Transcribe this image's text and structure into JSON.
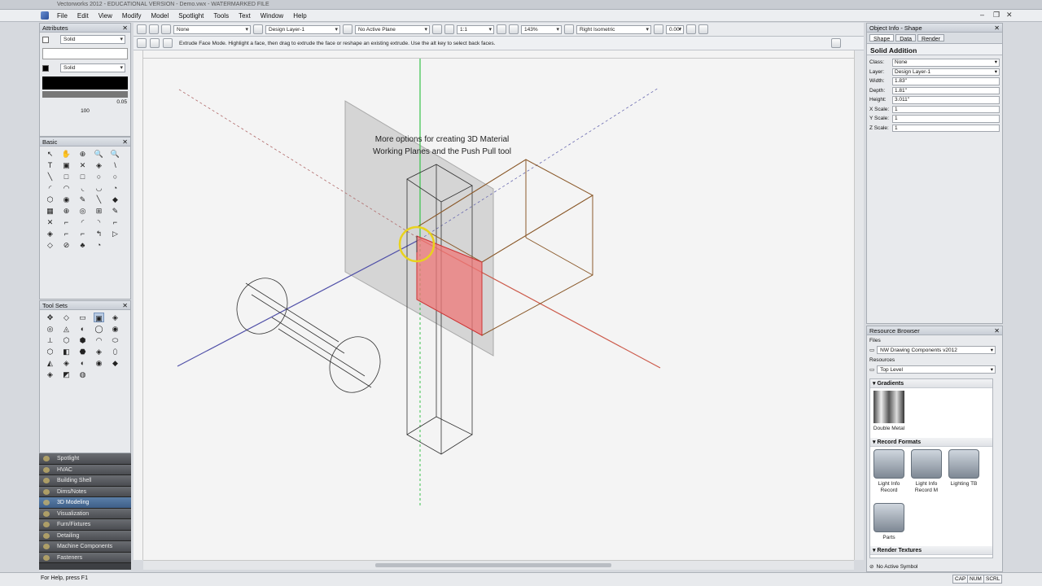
{
  "window": {
    "title": "Vectorworks 2012 - EDUCATIONAL VERSION - Demo.vwx - WATERMARKED FILE"
  },
  "menu": [
    "File",
    "Edit",
    "View",
    "Modify",
    "Model",
    "Spotlight",
    "Tools",
    "Text",
    "Window",
    "Help"
  ],
  "viewbar": {
    "class": "None",
    "layer": "Design Layer-1",
    "plane": "No Active Plane",
    "scale": "1:1",
    "zoom": "143%",
    "view": "Right Isometric",
    "rotation": "0.00°"
  },
  "mode": {
    "help": "Extrude Face Mode. Highlight a face, then drag to extrude the face or reshape an existing extrude. Use the alt key to select back faces."
  },
  "attributes": {
    "title": "Attributes",
    "fill": "Solid",
    "pen": "Solid",
    "thickness": "0.05",
    "opacity": "100"
  },
  "basic": {
    "title": "Basic",
    "tools": [
      "↖",
      "✋",
      "⊕",
      "🔍",
      "🔍",
      "T",
      "▣",
      "✕",
      "◈",
      "\\",
      "╲",
      "□",
      "□",
      "○",
      "○",
      "◜",
      "◠",
      "◟",
      "◡",
      "◔",
      "⬡",
      "◉",
      "✎",
      "╲",
      "◆",
      "▦",
      "⊕",
      "◎",
      "⊞",
      "✎",
      "✕",
      "⌐",
      "◜",
      "◝",
      "⌐",
      "◈",
      "⌐",
      "⌐",
      "↰",
      "▷",
      "◇",
      "⊘",
      "♣",
      "◔"
    ]
  },
  "toolsets": {
    "title": "Tool Sets",
    "tools": [
      "✥",
      "◇",
      "▭",
      "▣",
      "◈",
      "◎",
      "◬",
      "◐",
      "◯",
      "◉",
      "⟂",
      "⬡",
      "⬢",
      "◠",
      "⬭",
      "⬡",
      "◧",
      "⬣",
      "◈",
      "⬯",
      "◭",
      "◈",
      "◐",
      "◉",
      "◆",
      "◈",
      "◩",
      "◍"
    ]
  },
  "workspace": {
    "items": [
      "Spotlight",
      "HVAC",
      "Building Shell",
      "Dims/Notes",
      "3D Modeling",
      "Visualization",
      "Furn/Fixtures",
      "Detailing",
      "Machine Components",
      "Fasteners"
    ],
    "selected": 4
  },
  "overlay": {
    "line1": "More options for creating 3D Material",
    "line2": "Working Planes and the Push Pull tool"
  },
  "object_info": {
    "title": "Object Info - Shape",
    "tabs": [
      "Shape",
      "Data",
      "Render"
    ],
    "type": "Solid Addition",
    "fields": [
      {
        "label": "Class:",
        "value": "None",
        "dd": true
      },
      {
        "label": "Layer:",
        "value": "Design Layer-1",
        "dd": true
      },
      {
        "label": "Width:",
        "value": "1.83\""
      },
      {
        "label": "Depth:",
        "value": "1.81\""
      },
      {
        "label": "Height:",
        "value": "3.011\""
      },
      {
        "label": "X Scale:",
        "value": "1"
      },
      {
        "label": "Y Scale:",
        "value": "1"
      },
      {
        "label": "Z Scale:",
        "value": "1"
      }
    ]
  },
  "resource_browser": {
    "title": "Resource Browser",
    "files_label": "Files",
    "file": "NW Drawing Components v2012",
    "resources_label": "Resources",
    "folder": "Top Level",
    "sections": [
      "Gradients",
      "Record Formats",
      "Render Textures"
    ],
    "gradient": "Double Metal",
    "records": [
      {
        "line1": "Light Info",
        "line2": "Record"
      },
      {
        "line1": "Light Info",
        "line2": "Record M"
      },
      {
        "line1": "Lighting TB",
        "line2": ""
      },
      {
        "line1": "Parts",
        "line2": ""
      }
    ],
    "active_symbol": "No Active Symbol"
  },
  "status": {
    "help": "For Help, press F1",
    "cap": "CAP",
    "num": "NUM",
    "scrl": "SCRL"
  }
}
